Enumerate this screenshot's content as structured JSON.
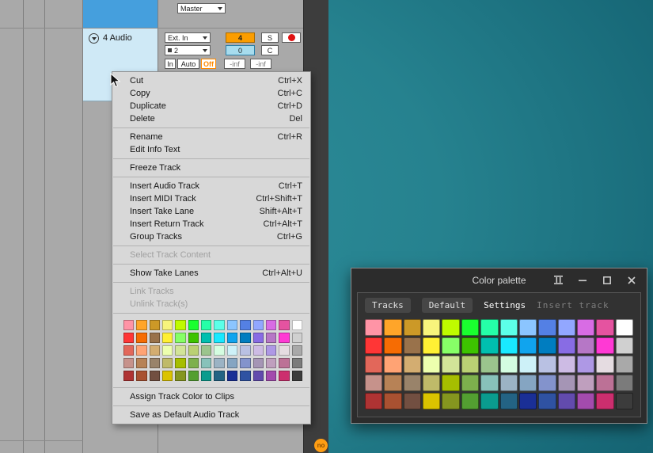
{
  "colors": {
    "selection_blue": "#459FDD",
    "track_header_blue": "#CFE9F6",
    "record_red": "#E01212",
    "input_orange": "#FB9D00",
    "value_cyan": "#A7DCEE",
    "monitor_off_orange": "#FF8A00",
    "badge_orange": "#FE9D13",
    "desktop_teal": "#26828F",
    "menu_bg": "#D8D8D8",
    "window_bg": "#2C2C2C"
  },
  "ableton": {
    "master_label": "Master",
    "track": {
      "name": "4 Audio",
      "io_input": "Ext. In",
      "input_channel": "4",
      "solo_label": "S",
      "sub_input": "2",
      "send_value": "0",
      "crossfade_label": "C",
      "monitor_in": "In",
      "monitor_auto": "Auto",
      "monitor_off": "Off",
      "meter_left": "-inf",
      "meter_right": "-inf"
    },
    "status_badge": "no"
  },
  "context_menu": {
    "items": [
      {
        "type": "item",
        "label": "Cut",
        "shortcut": "Ctrl+X"
      },
      {
        "type": "item",
        "label": "Copy",
        "shortcut": "Ctrl+C"
      },
      {
        "type": "item",
        "label": "Duplicate",
        "shortcut": "Ctrl+D"
      },
      {
        "type": "item",
        "label": "Delete",
        "shortcut": "Del"
      },
      {
        "type": "separator"
      },
      {
        "type": "item",
        "label": "Rename",
        "shortcut": "Ctrl+R"
      },
      {
        "type": "item",
        "label": "Edit Info Text",
        "shortcut": ""
      },
      {
        "type": "separator"
      },
      {
        "type": "item",
        "label": "Freeze Track",
        "shortcut": ""
      },
      {
        "type": "separator"
      },
      {
        "type": "item",
        "label": "Insert Audio Track",
        "shortcut": "Ctrl+T"
      },
      {
        "type": "item",
        "label": "Insert MIDI Track",
        "shortcut": "Ctrl+Shift+T"
      },
      {
        "type": "item",
        "label": "Insert Take Lane",
        "shortcut": "Shift+Alt+T"
      },
      {
        "type": "item",
        "label": "Insert Return Track",
        "shortcut": "Ctrl+Alt+T"
      },
      {
        "type": "item",
        "label": "Group Tracks",
        "shortcut": "Ctrl+G"
      },
      {
        "type": "separator"
      },
      {
        "type": "item",
        "label": "Select Track Content",
        "shortcut": "",
        "disabled": true
      },
      {
        "type": "separator"
      },
      {
        "type": "item",
        "label": "Show Take Lanes",
        "shortcut": "Ctrl+Alt+U"
      },
      {
        "type": "separator"
      },
      {
        "type": "item",
        "label": "Link Tracks",
        "shortcut": "",
        "disabled": true
      },
      {
        "type": "item",
        "label": "Unlink Track(s)",
        "shortcut": "",
        "disabled": true
      },
      {
        "type": "separator"
      },
      {
        "type": "palette"
      },
      {
        "type": "separator"
      },
      {
        "type": "item",
        "label": "Assign Track Color to Clips",
        "shortcut": ""
      },
      {
        "type": "separator"
      },
      {
        "type": "item",
        "label": "Save as Default Audio Track",
        "shortcut": ""
      }
    ],
    "palette_rows": [
      [
        "#FF94A6",
        "#FFA529",
        "#CC9927",
        "#F7F47C",
        "#BFFB00",
        "#1AFF2F",
        "#25FFA8",
        "#5CFFE8",
        "#8BC5FF",
        "#5480E4",
        "#92A7FF",
        "#D86CE4",
        "#E553A0",
        "#FFFFFF"
      ],
      [
        "#FF3636",
        "#F66C03",
        "#99724B",
        "#FFF034",
        "#87FF67",
        "#3DC300",
        "#00BFAF",
        "#19E9FF",
        "#10A4EE",
        "#007DC0",
        "#886CE4",
        "#B677C6",
        "#FF39D4",
        "#D0D0D0"
      ],
      [
        "#E2675A",
        "#FFA374",
        "#D3AD71",
        "#EDFFAE",
        "#D2E498",
        "#BAD074",
        "#9BC48D",
        "#D4FDE1",
        "#CDF1F8",
        "#B9C1E3",
        "#CDBBE4",
        "#AE98E5",
        "#E5DCE1",
        "#A9A9A9"
      ],
      [
        "#C6928B",
        "#B78256",
        "#99836A",
        "#BFBA69",
        "#A6BE00",
        "#7DB04D",
        "#88C2BA",
        "#9BB3C4",
        "#85A5C2",
        "#8393CC",
        "#A595B5",
        "#BF9FBE",
        "#BC7196",
        "#7B7B7B"
      ],
      [
        "#AF3333",
        "#A95131",
        "#724F41",
        "#DBC300",
        "#85961F",
        "#539F31",
        "#0A9C8E",
        "#236384",
        "#1A2F96",
        "#2F52A2",
        "#624BAD",
        "#A34BAD",
        "#CC2E6E",
        "#3C3C3C"
      ]
    ]
  },
  "palette_window": {
    "title": "Color palette",
    "tabs": [
      {
        "label": "Tracks",
        "state": "pill"
      },
      {
        "label": "Default",
        "state": "pill"
      },
      {
        "label": "Settings",
        "state": "active"
      },
      {
        "label": "Insert track",
        "state": "disabled"
      }
    ],
    "palette_rows": [
      [
        "#FF94A6",
        "#FFA529",
        "#CC9927",
        "#F7F47C",
        "#BFFB00",
        "#1AFF2F",
        "#25FFA8",
        "#5CFFE8",
        "#8BC5FF",
        "#5480E4",
        "#92A7FF",
        "#D86CE4",
        "#E553A0",
        "#FFFFFF"
      ],
      [
        "#FF3636",
        "#F66C03",
        "#99724B",
        "#FFF034",
        "#87FF67",
        "#3DC300",
        "#00BFAF",
        "#19E9FF",
        "#10A4EE",
        "#007DC0",
        "#886CE4",
        "#B677C6",
        "#FF39D4",
        "#D0D0D0"
      ],
      [
        "#E2675A",
        "#FFA374",
        "#D3AD71",
        "#EDFFAE",
        "#D2E498",
        "#BAD074",
        "#9BC48D",
        "#D4FDE1",
        "#CDF1F8",
        "#B9C1E3",
        "#CDBBE4",
        "#AE98E5",
        "#E5DCE1",
        "#A9A9A9"
      ],
      [
        "#C6928B",
        "#B78256",
        "#99836A",
        "#BFBA69",
        "#A6BE00",
        "#7DB04D",
        "#88C2BA",
        "#9BB3C4",
        "#85A5C2",
        "#8393CC",
        "#A595B5",
        "#BF9FBE",
        "#BC7196",
        "#7B7B7B"
      ],
      [
        "#AF3333",
        "#A95131",
        "#724F41",
        "#DBC300",
        "#85961F",
        "#539F31",
        "#0A9C8E",
        "#236384",
        "#1A2F96",
        "#2F52A2",
        "#624BAD",
        "#A34BAD",
        "#CC2E6E",
        "#3C3C3C"
      ]
    ]
  }
}
